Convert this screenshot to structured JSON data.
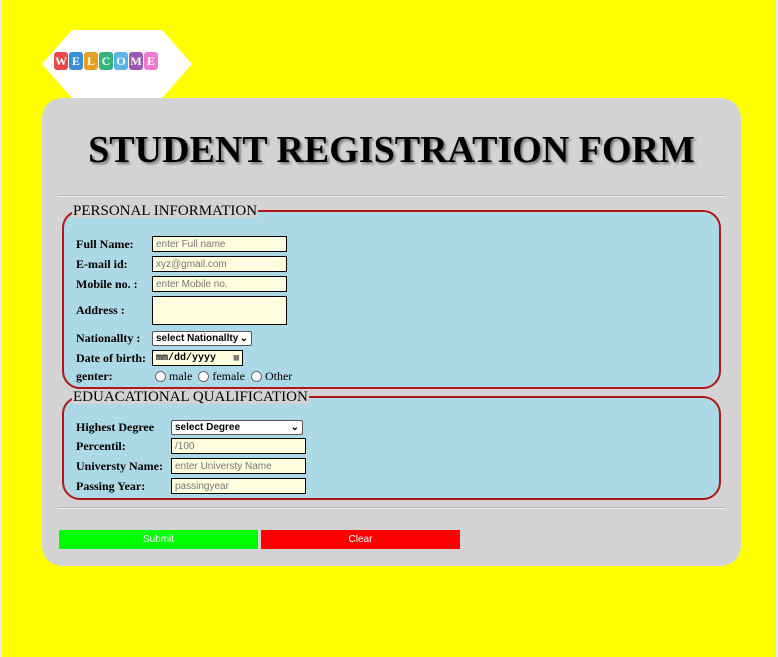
{
  "logo": {
    "letters": [
      "W",
      "E",
      "L",
      "C",
      "O",
      "M",
      "E"
    ],
    "colors": [
      "#e84a4a",
      "#3b8fd9",
      "#e6a020",
      "#36b37e",
      "#5ab4e6",
      "#9b59b6",
      "#f07ad0"
    ]
  },
  "title": "STUDENT REGISTRATION FORM",
  "personal": {
    "legend": "PERSONAL INFORMATION",
    "fullname_label": "Full Name:",
    "fullname_placeholder": "enter Full name",
    "email_label": "E-mail id:",
    "email_placeholder": "xyz@gmail.com",
    "mobile_label": "Mobile no. :",
    "mobile_placeholder": "enter Mobile no.",
    "address_label": "Address :",
    "nationality_label": "Nationallty :",
    "nationality_value": "select Nationallty",
    "dob_label": "Date of birth:",
    "dob_value": "mm/dd/yyyy",
    "gender_label": "genter:",
    "gender_options": [
      "male",
      "female",
      "Other"
    ]
  },
  "education": {
    "legend": "EDUACATIONAL QUALIFICATION",
    "degree_label": "Highest Degree",
    "degree_value": "select Degree",
    "percent_label": "Percentil:",
    "percent_placeholder": "/100",
    "university_label": "Universty Name:",
    "university_placeholder": "enter Universty Name",
    "year_label": "Passing Year:",
    "year_placeholder": "passingyear"
  },
  "buttons": {
    "submit_label": "Submit",
    "submit_color": "#00ff00",
    "clear_label": "Clear",
    "clear_color": "#ff0000"
  }
}
